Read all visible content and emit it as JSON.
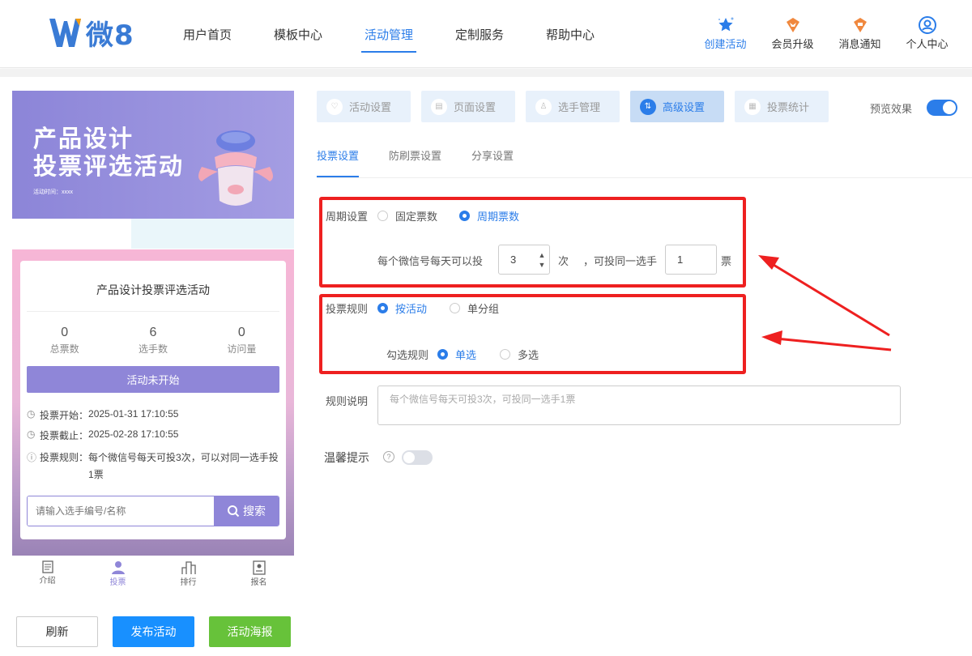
{
  "header": {
    "logo_text": "微8",
    "nav": [
      "用户首页",
      "模板中心",
      "活动管理",
      "定制服务",
      "帮助中心"
    ],
    "active_nav_index": 2,
    "right_nav": [
      {
        "label": "创建活动",
        "icon": "star-icon"
      },
      {
        "label": "会员升级",
        "icon": "crown-icon"
      },
      {
        "label": "消息通知",
        "icon": "bell-icon"
      },
      {
        "label": "个人中心",
        "icon": "user-icon"
      }
    ]
  },
  "preview": {
    "banner_title_line1": "产品设计",
    "banner_title_line2": "投票评选活动",
    "banner_time": "活动时间：xxxx",
    "card_title": "产品设计投票评选活动",
    "stats": [
      {
        "value": "0",
        "label": "总票数"
      },
      {
        "value": "6",
        "label": "选手数"
      },
      {
        "value": "0",
        "label": "访问量"
      }
    ],
    "status_button": "活动未开始",
    "vote_start_label": "投票开始：",
    "vote_start": "2025-01-31 17:10:55",
    "vote_end_label": "投票截止：",
    "vote_end": "2025-02-28 17:10:55",
    "vote_rule_label": "投票规则：",
    "vote_rule": "每个微信号每天可投3次，可以对同一选手投1票",
    "search_placeholder": "请输入选手编号/名称",
    "search_button": "搜索",
    "tabbar": [
      "介绍",
      "投票",
      "排行",
      "报名"
    ],
    "active_tab_index": 1
  },
  "bottom_buttons": {
    "refresh": "刷新",
    "publish": "发布活动",
    "poster": "活动海报"
  },
  "step_tabs": [
    "活动设置",
    "页面设置",
    "选手管理",
    "高级设置",
    "投票统计"
  ],
  "active_step_index": 3,
  "preview_toggle_label": "预览效果",
  "preview_toggle_on": true,
  "sub_tabs": [
    "投票设置",
    "防刷票设置",
    "分享设置"
  ],
  "active_sub_tab_index": 0,
  "settings": {
    "cycle_label": "周期设置",
    "cycle_options": [
      "固定票数",
      "周期票数"
    ],
    "cycle_selected": 1,
    "per_day_prefix": "每个微信号每天可以投",
    "per_day_value": "3",
    "per_day_unit": "次",
    "same_player_prefix": "，可投同一选手",
    "same_player_value": "1",
    "same_player_unit": "票",
    "rule_label": "投票规则",
    "rule_options": [
      "按活动",
      "单分组"
    ],
    "rule_selected": 0,
    "check_label": "勾选规则",
    "check_options": [
      "单选",
      "多选"
    ],
    "check_selected": 0,
    "desc_label": "规则说明",
    "desc_placeholder": "每个微信号每天可投3次，可投同一选手1票",
    "tip_label": "温馨提示",
    "tip_on": false
  },
  "colors": {
    "accent": "#2b7de9",
    "purple": "#8f86d8",
    "annotation": "#ee2020",
    "green": "#67c23a"
  }
}
